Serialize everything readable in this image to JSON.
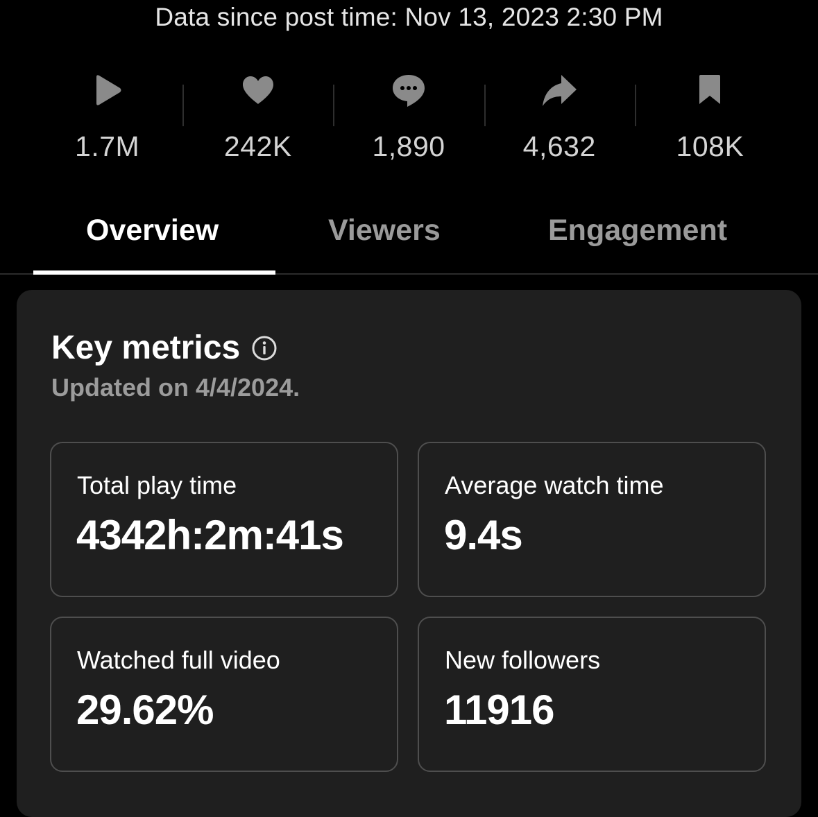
{
  "header": {
    "post_time": "Data since post time: Nov 13, 2023 2:30 PM"
  },
  "stats": [
    {
      "icon": "play-icon",
      "value": "1.7M"
    },
    {
      "icon": "heart-icon",
      "value": "242K"
    },
    {
      "icon": "comment-icon",
      "value": "1,890"
    },
    {
      "icon": "share-icon",
      "value": "4,632"
    },
    {
      "icon": "bookmark-icon",
      "value": "108K"
    }
  ],
  "tabs": [
    {
      "label": "Overview",
      "active": true
    },
    {
      "label": "Viewers",
      "active": false
    },
    {
      "label": "Engagement",
      "active": false
    }
  ],
  "key_metrics": {
    "title": "Key metrics",
    "info_icon": "info-icon",
    "updated": "Updated on 4/4/2024.",
    "metrics": [
      {
        "label": "Total play time",
        "value": "4342h:2m:41s"
      },
      {
        "label": "Average watch time",
        "value": "9.4s"
      },
      {
        "label": "Watched full video",
        "value": "29.62%"
      },
      {
        "label": "New followers",
        "value": "11916"
      }
    ]
  },
  "colors": {
    "background": "#000000",
    "card": "#1f1f1f",
    "icon": "#8a8a8a",
    "muted_text": "#9c9c9c",
    "active_tab": "#ffffff"
  }
}
